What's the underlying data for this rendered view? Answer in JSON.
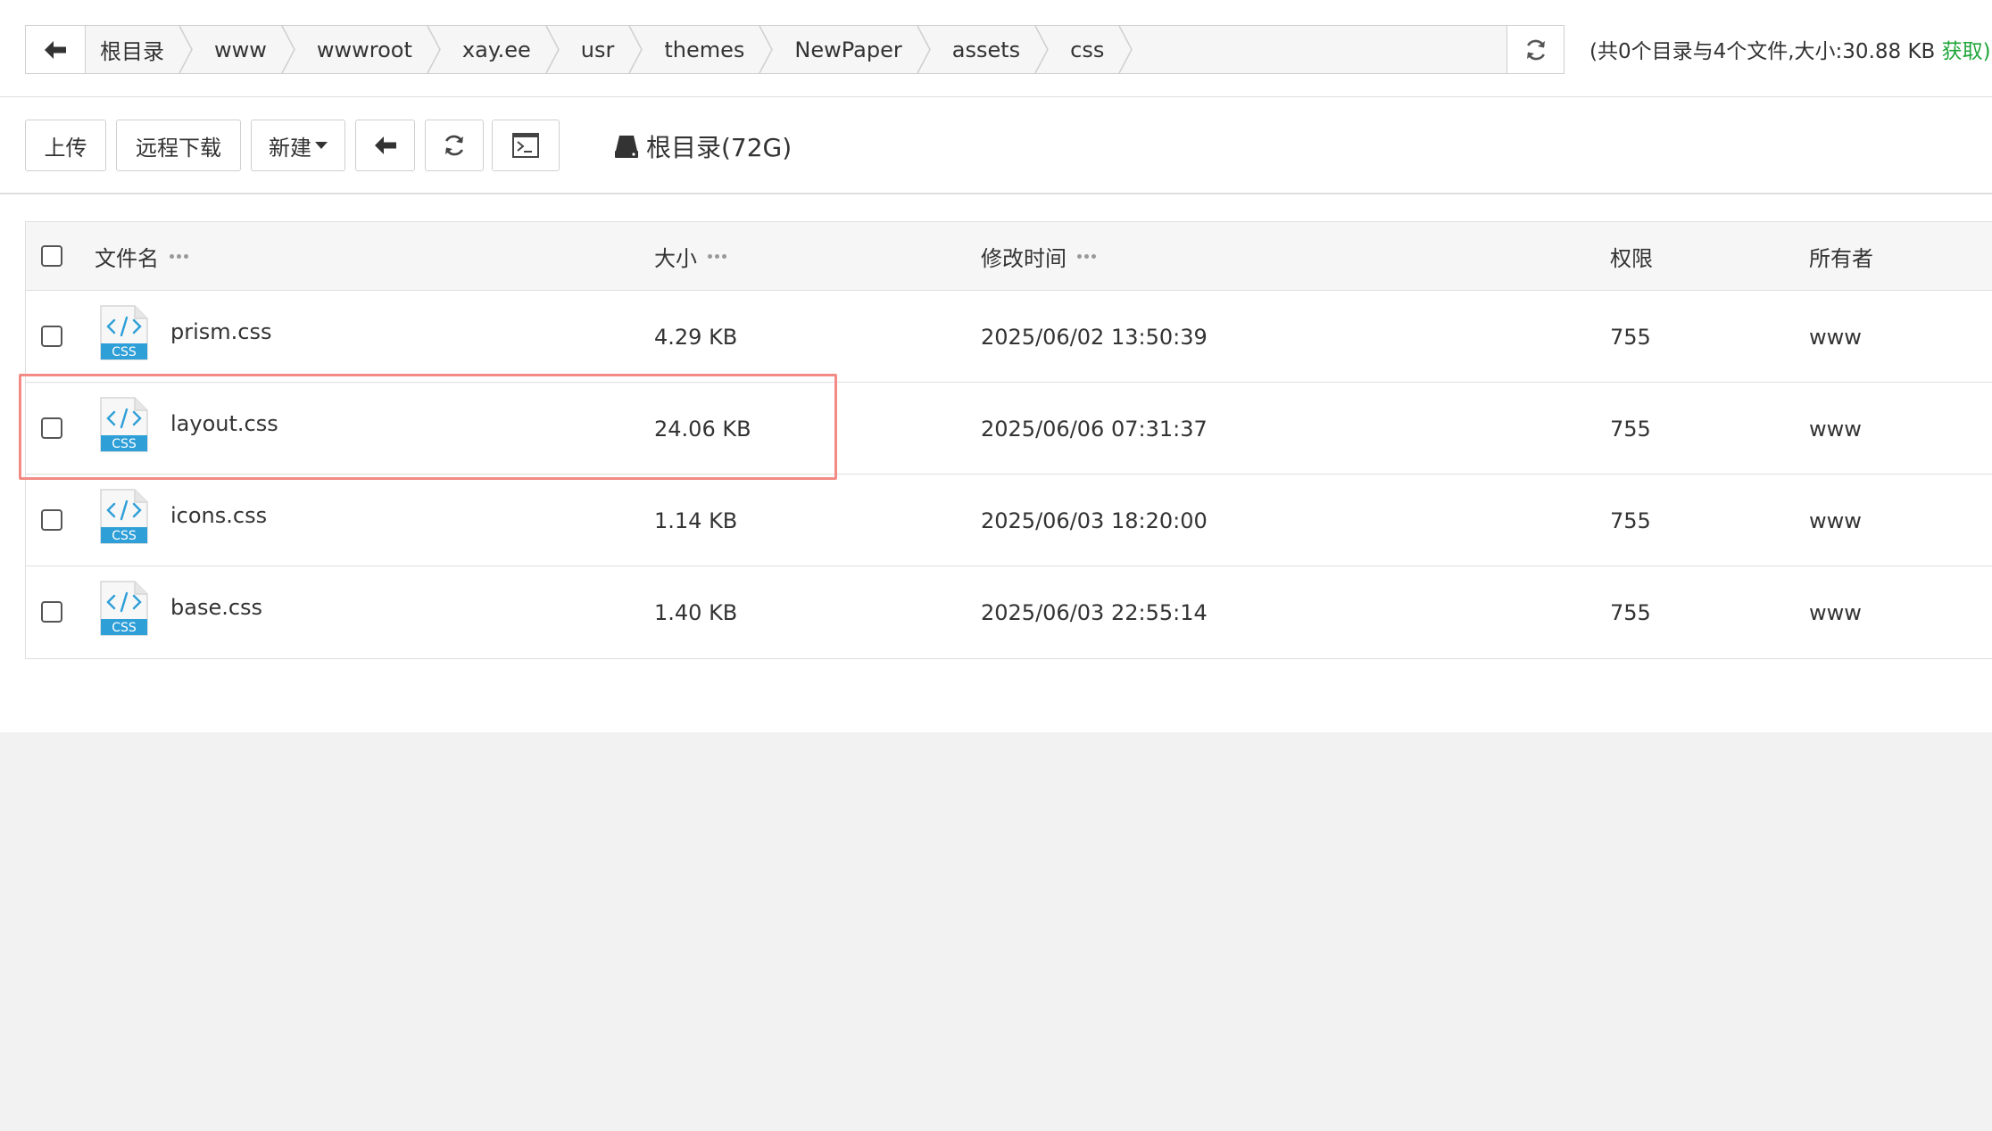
{
  "path_bar": {
    "crumbs": [
      "根目录",
      "www",
      "wwwroot",
      "xay.ee",
      "usr",
      "themes",
      "NewPaper",
      "assets",
      "css"
    ],
    "summary": "(共0个目录与4个文件,大小:30.88 KB",
    "fetch_label": "获取)"
  },
  "toolbar": {
    "upload_label": "上传",
    "remote_download_label": "远程下载",
    "new_label": "新建",
    "disk_label": "根目录(72G)"
  },
  "table": {
    "headers": {
      "name": "文件名",
      "size": "大小",
      "mtime": "修改时间",
      "perm": "权限",
      "owner": "所有者"
    },
    "rows": [
      {
        "name": "prism.css",
        "icon_text": "CSS",
        "size": "4.29 KB",
        "mtime": "2025/06/02 13:50:39",
        "perm": "755",
        "owner": "www"
      },
      {
        "name": "layout.css",
        "icon_text": "CSS",
        "size": "24.06 KB",
        "mtime": "2025/06/06 07:31:37",
        "perm": "755",
        "owner": "www"
      },
      {
        "name": "icons.css",
        "icon_text": "CSS",
        "size": "1.14 KB",
        "mtime": "2025/06/03 18:20:00",
        "perm": "755",
        "owner": "www"
      },
      {
        "name": "base.css",
        "icon_text": "CSS",
        "size": "1.40 KB",
        "mtime": "2025/06/03 22:55:14",
        "perm": "755",
        "owner": "www"
      }
    ]
  },
  "colors": {
    "accent_green": "#20a53a",
    "highlight_border": "#f28b85",
    "css_icon_blue": "#2f9fd8"
  },
  "icons": {
    "back": "arrow-left-icon",
    "refresh": "refresh-icon",
    "terminal": "terminal-icon",
    "disk": "hard-drive-icon",
    "file": "css-file-icon"
  }
}
